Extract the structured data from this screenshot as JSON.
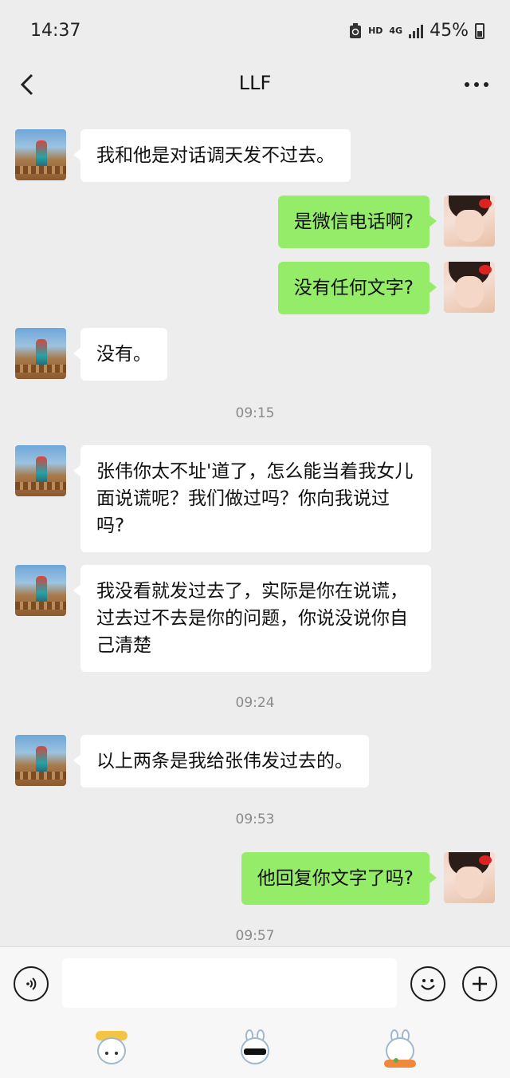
{
  "status_bar": {
    "time": "14:37",
    "hd_label": "HD",
    "network_label": "4G",
    "battery_percent": "45%"
  },
  "nav": {
    "title": "LLF"
  },
  "messages": [
    {
      "side": "left",
      "text": "我和他是对话调天发不过去。"
    },
    {
      "side": "right",
      "text": "是微信电话啊?"
    },
    {
      "side": "right",
      "text": "没有任何文字?"
    },
    {
      "side": "left",
      "text": "没有。"
    },
    {
      "timestamp": "09:15"
    },
    {
      "side": "left",
      "text": "张伟你太不址'道了，怎么能当着我女儿面说谎呢？我们做过吗？你向我说过吗?"
    },
    {
      "side": "left",
      "text": "我没看就发过去了，实际是你在说谎，过去过不去是你的问题，你说没说你自己清楚"
    },
    {
      "timestamp": "09:24"
    },
    {
      "side": "left",
      "text": "以上两条是我给张伟发过去的。"
    },
    {
      "timestamp": "09:53"
    },
    {
      "side": "right",
      "text": "他回复你文字了吗?"
    },
    {
      "timestamp": "09:57"
    }
  ],
  "input": {
    "placeholder": ""
  },
  "icons": {
    "back": "chevron-left-icon",
    "more": "more-dots-icon",
    "voice": "voice-icon",
    "emoji": "emoji-icon",
    "plus": "plus-icon"
  },
  "colors": {
    "sent_bubble": "#95ec69",
    "received_bubble": "#ffffff",
    "background": "#ededed"
  }
}
